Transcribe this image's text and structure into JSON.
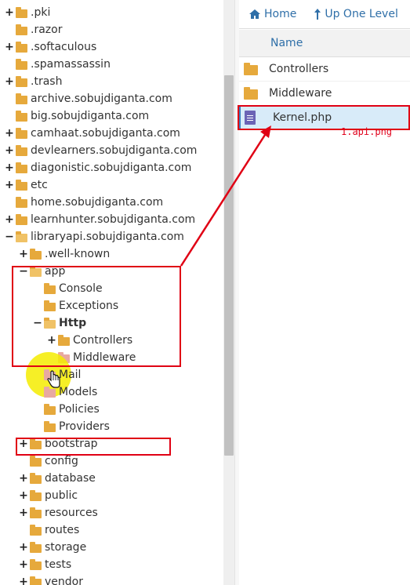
{
  "tree": {
    "items": [
      {
        "label": ".pki",
        "toggle": "+",
        "folder": "closed"
      },
      {
        "label": ".razor",
        "toggle": "",
        "folder": "closed"
      },
      {
        "label": ".softaculous",
        "toggle": "+",
        "folder": "closed"
      },
      {
        "label": ".spamassassin",
        "toggle": "",
        "folder": "closed"
      },
      {
        "label": ".trash",
        "toggle": "+",
        "folder": "closed"
      },
      {
        "label": "archive.sobujdiganta.com",
        "toggle": "",
        "folder": "closed"
      },
      {
        "label": "big.sobujdiganta.com",
        "toggle": "",
        "folder": "closed"
      },
      {
        "label": "camhaat.sobujdiganta.com",
        "toggle": "+",
        "folder": "closed"
      },
      {
        "label": "devlearners.sobujdiganta.com",
        "toggle": "+",
        "folder": "closed"
      },
      {
        "label": "diagonistic.sobujdiganta.com",
        "toggle": "+",
        "folder": "closed"
      },
      {
        "label": "etc",
        "toggle": "+",
        "folder": "closed"
      },
      {
        "label": "home.sobujdiganta.com",
        "toggle": "",
        "folder": "closed"
      },
      {
        "label": "learnhunter.sobujdiganta.com",
        "toggle": "+",
        "folder": "closed"
      },
      {
        "label": "libraryapi.sobujdiganta.com",
        "toggle": "−",
        "folder": "open"
      },
      {
        "label": ".well-known",
        "toggle": "+",
        "folder": "closed"
      },
      {
        "label": "app",
        "toggle": "−",
        "folder": "open"
      },
      {
        "label": "Console",
        "toggle": "",
        "folder": "closed"
      },
      {
        "label": "Exceptions",
        "toggle": "",
        "folder": "closed"
      },
      {
        "label": "Http",
        "toggle": "−",
        "folder": "open"
      },
      {
        "label": "Controllers",
        "toggle": "+",
        "folder": "closed"
      },
      {
        "label": "Middleware",
        "toggle": "",
        "folder": "pink"
      },
      {
        "label": "Mail",
        "toggle": "",
        "folder": "pink"
      },
      {
        "label": "Models",
        "toggle": "",
        "folder": "pink"
      },
      {
        "label": "Policies",
        "toggle": "",
        "folder": "closed"
      },
      {
        "label": "Providers",
        "toggle": "",
        "folder": "closed"
      },
      {
        "label": "bootstrap",
        "toggle": "+",
        "folder": "closed"
      },
      {
        "label": "config",
        "toggle": "",
        "folder": "closed"
      },
      {
        "label": "database",
        "toggle": "+",
        "folder": "closed"
      },
      {
        "label": "public",
        "toggle": "+",
        "folder": "closed"
      },
      {
        "label": "resources",
        "toggle": "+",
        "folder": "closed"
      },
      {
        "label": "routes",
        "toggle": "",
        "folder": "closed"
      },
      {
        "label": "storage",
        "toggle": "+",
        "folder": "closed"
      },
      {
        "label": "tests",
        "toggle": "+",
        "folder": "closed"
      },
      {
        "label": "vendor",
        "toggle": "+",
        "folder": "closed"
      }
    ]
  },
  "toolbar": {
    "home_label": "Home",
    "home_icon": "home-icon",
    "up_label": "Up One Level",
    "up_icon": "level-up-icon"
  },
  "file_list": {
    "header_name": "Name",
    "files": [
      {
        "name": "Controllers",
        "type": "folder",
        "selected": false
      },
      {
        "name": "Middleware",
        "type": "folder",
        "selected": false
      },
      {
        "name": "Kernel.php",
        "type": "file",
        "selected": true
      }
    ]
  },
  "annotation_text": "1.api.png",
  "colors": {
    "accent_link": "#2f6fa8",
    "folder": "#e6a93c",
    "selection_bg": "#d8ebf9",
    "annotation_red": "#e00014",
    "cursor_highlight": "#f5ec00"
  }
}
